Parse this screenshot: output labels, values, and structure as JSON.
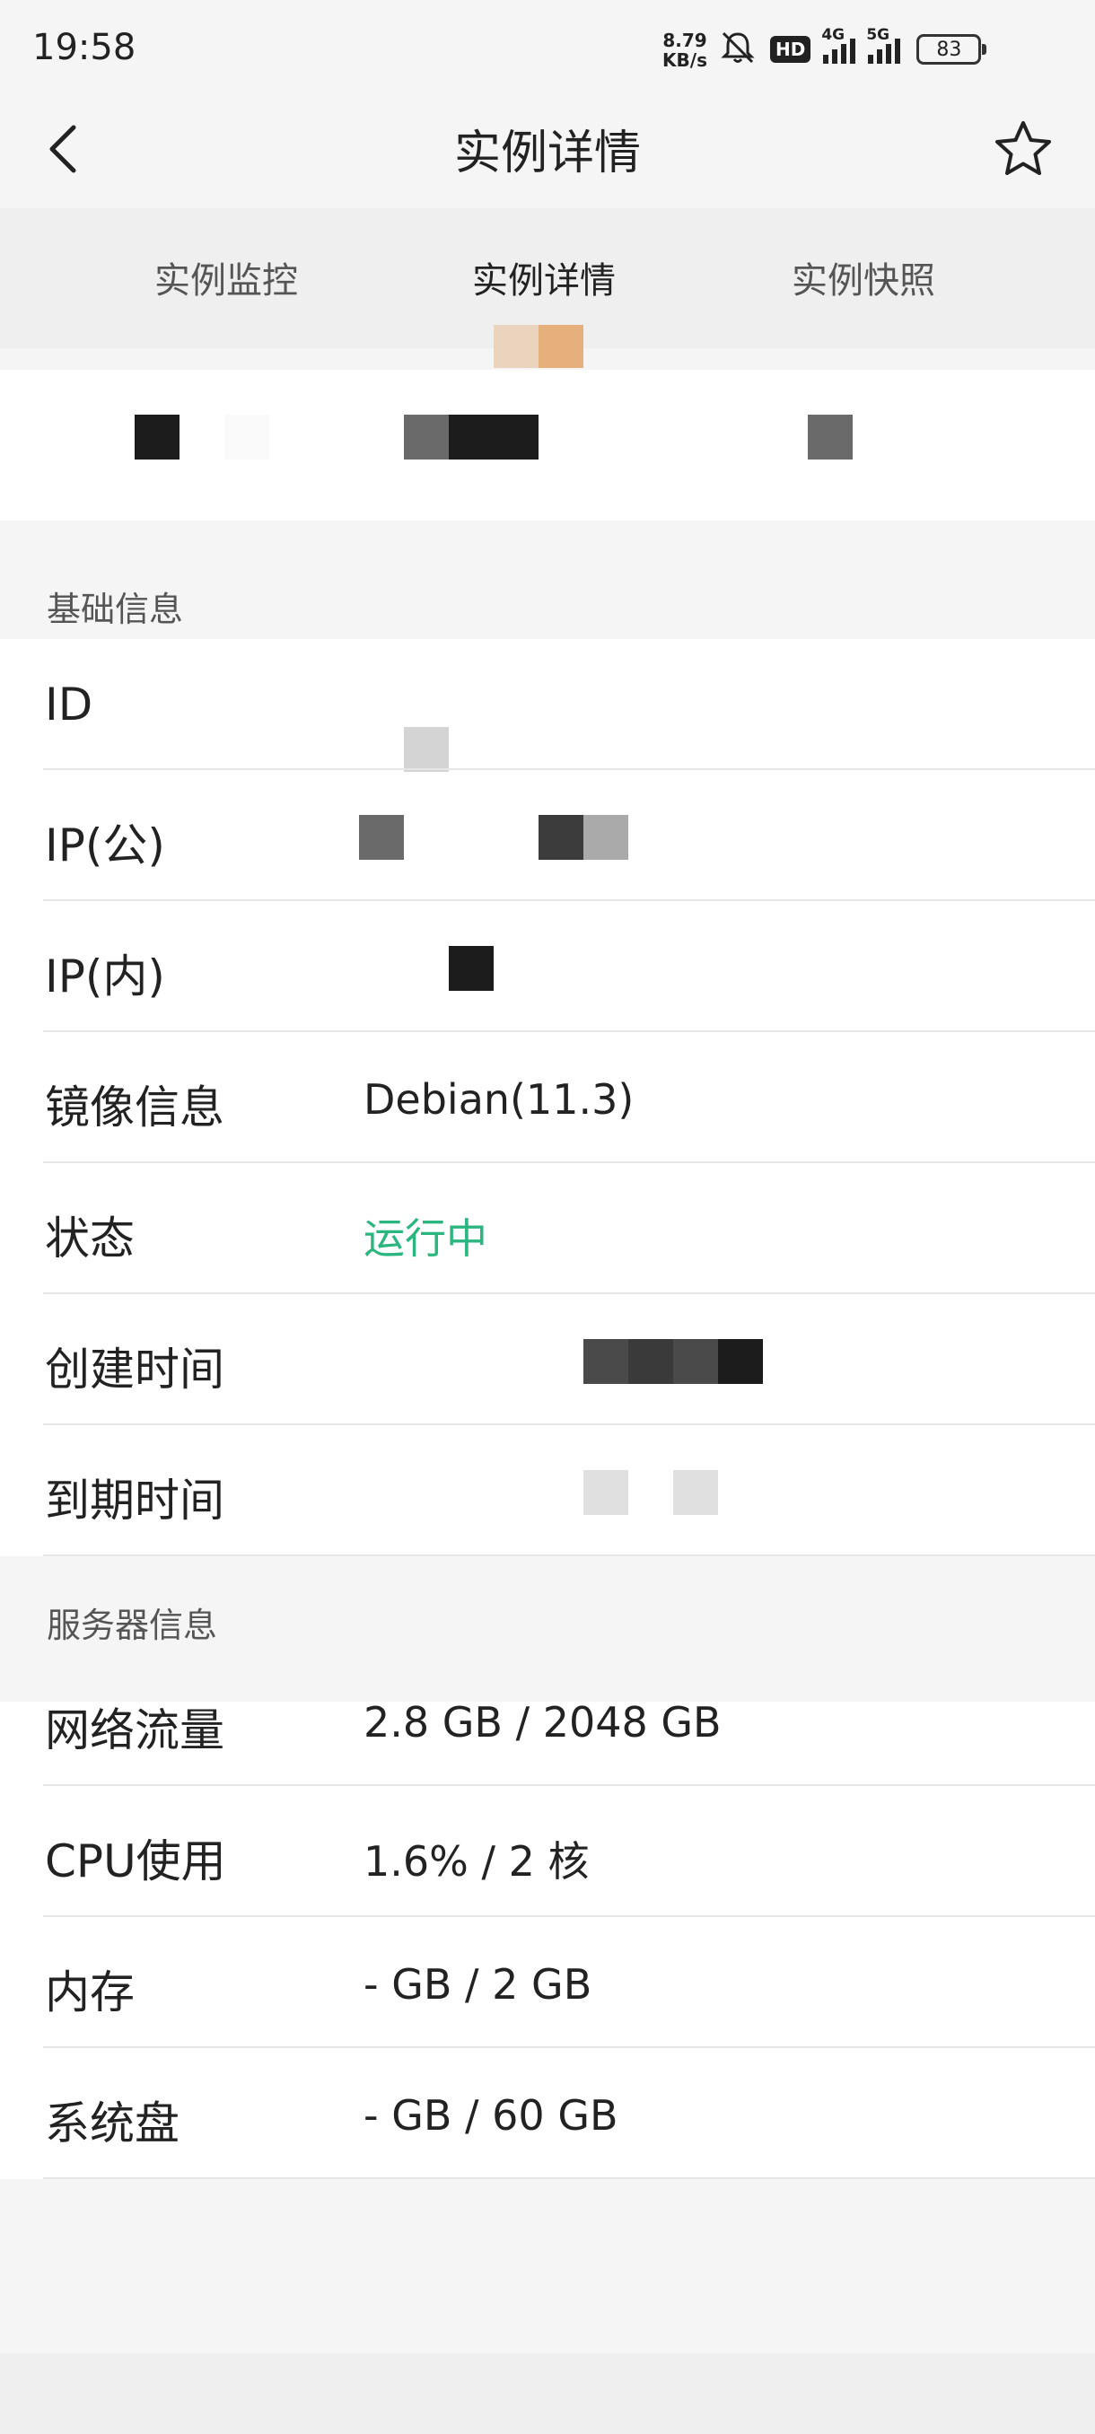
{
  "status_bar": {
    "time": "19:58",
    "net_speed": "8.79",
    "net_unit": "KB/s",
    "icons": [
      "mute-icon",
      "hd-icon",
      "signal-4g-icon",
      "signal-5g-icon",
      "battery-icon"
    ],
    "hd_label": "HD",
    "net_4g": "4G",
    "net_5g": "5G",
    "battery": "83"
  },
  "header": {
    "title": "实例详情",
    "back_icon": "chevron-left-icon",
    "favorite_icon": "star-outline-icon"
  },
  "tabs": [
    {
      "label": "实例监控",
      "active": false
    },
    {
      "label": "实例详情",
      "active": true
    },
    {
      "label": "实例快照",
      "active": false
    }
  ],
  "colors": {
    "accent_green": "#2bb67f",
    "indicator_light": "#ebd4bd",
    "indicator_dark": "#e6b07c"
  },
  "sections": {
    "basic": {
      "title": "基础信息",
      "rows": [
        {
          "label": "ID",
          "value": ""
        },
        {
          "label": "IP(公)",
          "value": ""
        },
        {
          "label": "IP(内)",
          "value": ""
        },
        {
          "label": "镜像信息",
          "value": "Debian(11.3)"
        },
        {
          "label": "状态",
          "value": "运行中"
        },
        {
          "label": "创建时间",
          "value": ""
        },
        {
          "label": "到期时间",
          "value": ""
        }
      ]
    },
    "server": {
      "title": "服务器信息",
      "rows": [
        {
          "label": "网络流量",
          "value": "2.8 GB / 2048 GB"
        },
        {
          "label": "CPU使用",
          "value": "1.6% / 2 核"
        },
        {
          "label": "内存",
          "value": "- GB / 2 GB"
        },
        {
          "label": "系统盘",
          "value": "- GB / 60 GB"
        }
      ]
    }
  }
}
